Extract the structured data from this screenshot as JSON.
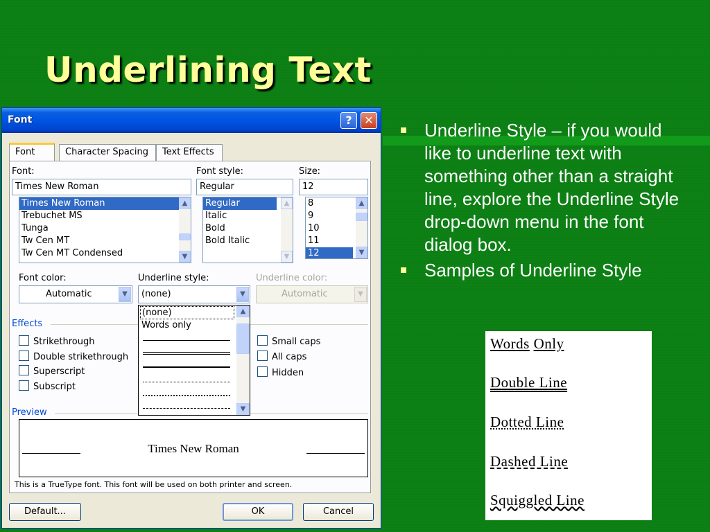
{
  "slide": {
    "title": "Underlining Text",
    "bullets": [
      "Underline Style – if you would like to underline text with something other than a straight line, explore the Underline Style drop-down menu in the font dialog box.",
      "Samples of Underline Style"
    ],
    "samples": [
      "Words Only",
      "Double Line",
      "Dotted Line",
      "Dashed Line",
      "Squiggled Line"
    ],
    "colors": {
      "background": "#0d7f14",
      "title": "#ffff99",
      "bullet_text": "#ffffff"
    }
  },
  "dialog": {
    "title": "Font",
    "help_button": "?",
    "close_button": "✕",
    "tabs": [
      "Font",
      "Character Spacing",
      "Text Effects"
    ],
    "font_label": "Font:",
    "font_value": "Times New Roman",
    "font_list": [
      "Times New Roman",
      "Trebuchet MS",
      "Tunga",
      "Tw Cen MT",
      "Tw Cen MT Condensed"
    ],
    "style_label": "Font style:",
    "style_value": "Regular",
    "style_list": [
      "Regular",
      "Italic",
      "Bold",
      "Bold Italic"
    ],
    "size_label": "Size:",
    "size_value": "12",
    "size_list": [
      "8",
      "9",
      "10",
      "11",
      "12"
    ],
    "font_color_label": "Font color:",
    "font_color_value": "Automatic",
    "underline_style_label": "Underline style:",
    "underline_style_value": "(none)",
    "underline_color_label": "Underline color:",
    "underline_color_value": "Automatic",
    "effects_label": "Effects",
    "effects_left": [
      "Strikethrough",
      "Double strikethrough",
      "Superscript",
      "Subscript"
    ],
    "effects_right": [
      "Small caps",
      "All caps",
      "Hidden"
    ],
    "preview_label": "Preview",
    "preview_text": "Times New Roman",
    "info_text": "This is a TrueType font. This font will be used on both printer and screen.",
    "default_button": "Default...",
    "ok_button": "OK",
    "cancel_button": "Cancel",
    "underline_options": [
      "(none)",
      "Words only"
    ]
  }
}
